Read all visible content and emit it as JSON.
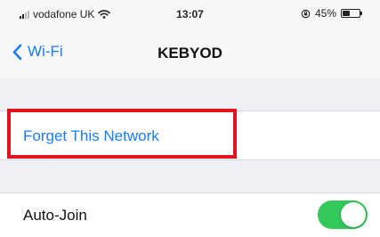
{
  "status_bar": {
    "carrier": "vodafone UK",
    "time": "13:07",
    "battery_text": "45%",
    "battery_level": 0.45
  },
  "nav": {
    "back_label": "Wi-Fi",
    "title": "KEBYOD"
  },
  "actions": {
    "forget_label": "Forget This Network"
  },
  "settings": {
    "auto_join_label": "Auto-Join",
    "auto_join_on": true
  },
  "colors": {
    "accent_blue": "#1a7cf5",
    "toggle_green": "#34c759",
    "highlight_red": "#e0141e",
    "group_background": "#efeff4"
  },
  "icons": [
    "signal-icon",
    "wifi-icon",
    "rotation-lock-icon",
    "battery-icon",
    "chevron-left-icon"
  ]
}
